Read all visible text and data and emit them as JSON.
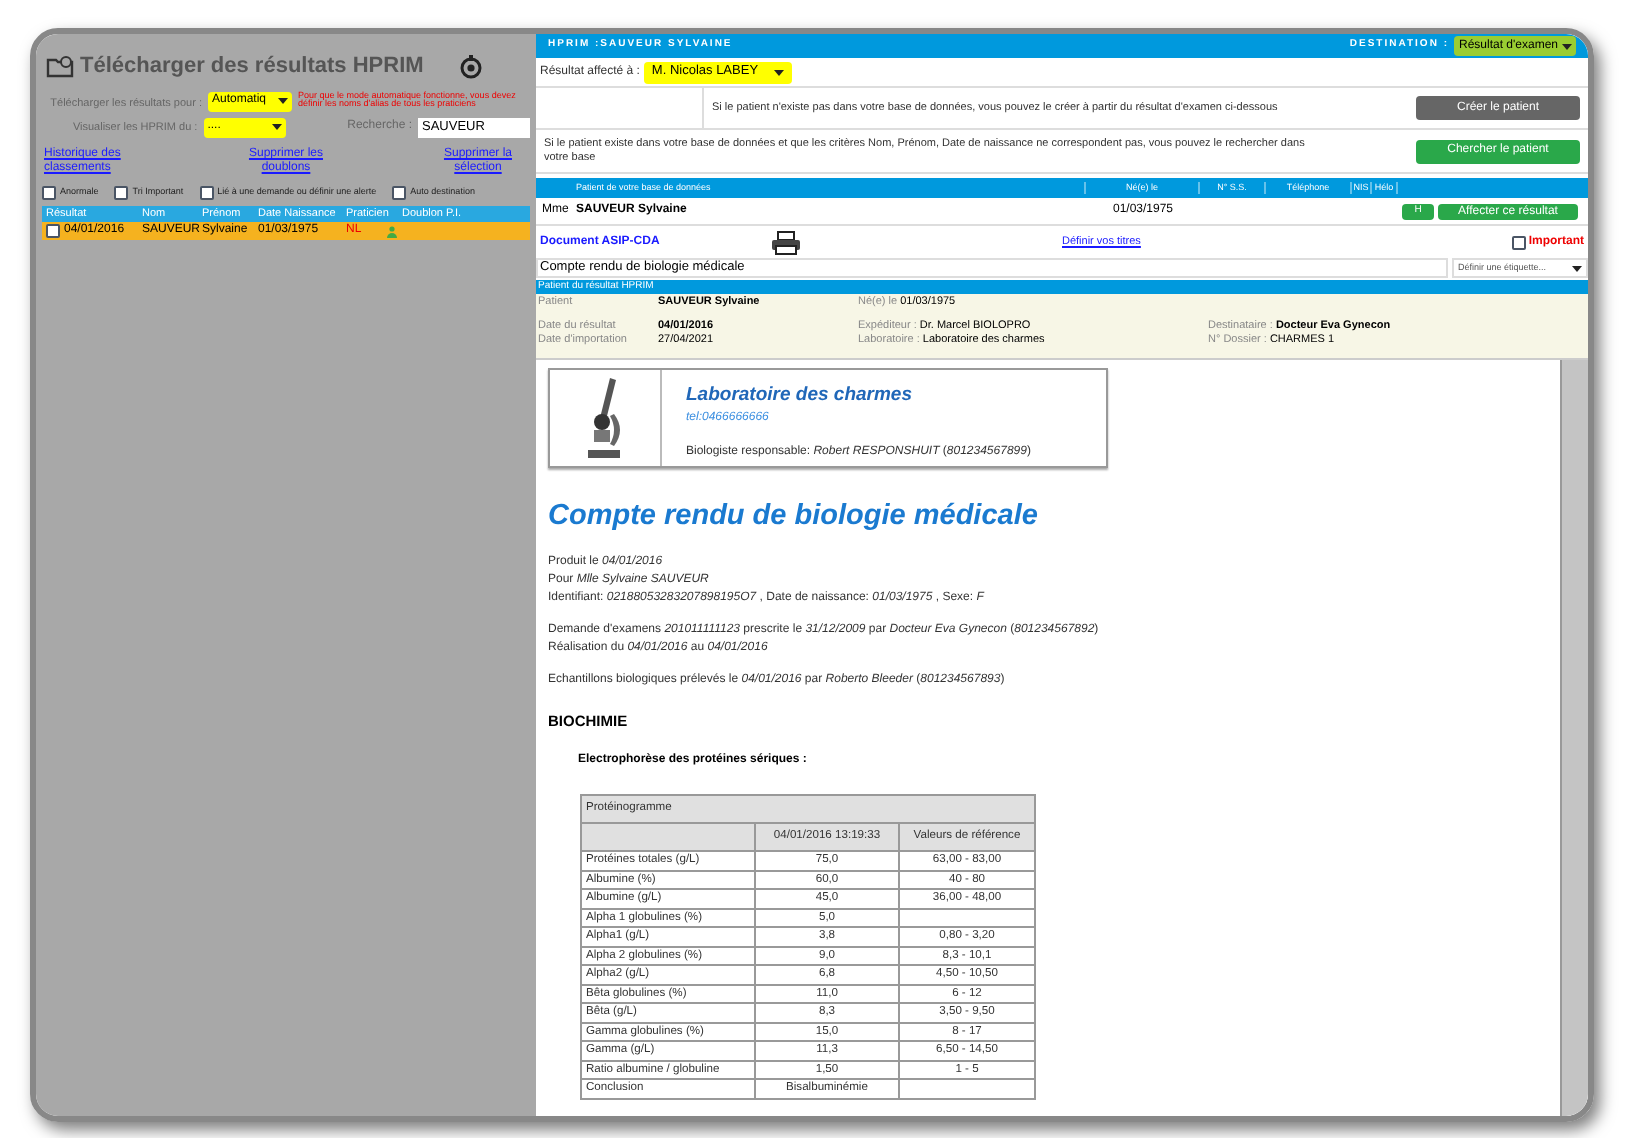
{
  "left": {
    "title": "Télécharger des résultats HPRIM",
    "download_for": {
      "label": "Télécharger les résultats pour :",
      "value": "Automatiq",
      "note": "Pour que le mode automatique fonctionne, vous devez définir les noms d'alias de tous les praticiens"
    },
    "view_hprim": {
      "label": "Visualiser les HPRIM du :",
      "value": "...."
    },
    "search": {
      "label": "Recherche :",
      "value": "SAUVEUR"
    },
    "links": [
      "Historique des classements",
      "Supprimer les doublons",
      "Supprimer la sélection"
    ],
    "filters": [
      {
        "label": "Anormale",
        "checked": false
      },
      {
        "label": "Tri Important",
        "checked": false
      },
      {
        "label": "Lié à une demande ou définir une alerte",
        "checked": false
      },
      {
        "label": "Auto destination",
        "checked": false
      }
    ],
    "table": {
      "columns": [
        "Résultat",
        "Nom",
        "Prénom",
        "Date Naissance",
        "Praticien",
        "Doublon P.I."
      ],
      "rows": [
        {
          "checked": false,
          "selected": true,
          "cells": [
            "04/01/2016",
            "SAUVEUR",
            "Sylvaine",
            "01/03/1975",
            "NL",
            ""
          ]
        }
      ]
    }
  },
  "right": {
    "header": {
      "title": "HPRIM :SAUVEUR SYLVAINE",
      "destination_label": "DESTINATION :",
      "destination_value": "Résultat d'examen"
    },
    "assigned": {
      "label": "Résultat affecté à :",
      "value": "M. Nicolas LABEY"
    },
    "create": {
      "text": "Si le patient n'existe pas dans votre base de données, vous pouvez le créer à partir du résultat d'examen ci-dessous",
      "button": "Créer le patient"
    },
    "find": {
      "text": "Si le patient existe dans votre base de données et que les critères Nom, Prénom, Date de naissance ne correspondent pas, vous pouvez le rechercher dans votre base",
      "button": "Chercher le patient"
    },
    "patients": {
      "columns": [
        "Patient de votre base de données",
        "Né(e) le",
        "N° S.S.",
        "Téléphone",
        "NIS",
        "Hélo"
      ],
      "rows": [
        {
          "civility": "Mme",
          "name": "SAUVEUR Sylvaine",
          "birth": "01/03/1975",
          "h_button": "H",
          "assign_button": "Affecter ce résultat"
        }
      ]
    },
    "document": {
      "type_link": "Document ASIP-CDA",
      "titles_link": "Définir vos titres",
      "important": {
        "label": "Important",
        "checked": false
      },
      "title_value": "Compte rendu de biologie médicale",
      "label_select": "Définir une étiquette..."
    },
    "hprim_patient": {
      "header": "Patient du résultat HPRIM",
      "fields": [
        {
          "label": "Patient",
          "value": "SAUVEUR Sylvaine"
        },
        {
          "label": "Né(e) le",
          "value": "01/03/1975"
        },
        {
          "label": "Date du résultat",
          "value": "04/01/2016"
        },
        {
          "label": "Expéditeur :",
          "value": "Dr. Marcel BIOLOPRO"
        },
        {
          "label": "Destinataire :",
          "value": "Docteur Eva Gynecon"
        },
        {
          "label": "Date d'importation",
          "value": "27/04/2021"
        },
        {
          "label": "Laboratoire :",
          "value": "Laboratoire des charmes"
        },
        {
          "label": "N° Dossier :",
          "value": "CHARMES 1"
        }
      ]
    },
    "report": {
      "lab_name": "Laboratoire des charmes",
      "tel": "tel:0466666666",
      "biologist": "Biologiste responsable: *Robert RESPONSHUIT* (*801234567899*)",
      "title": "Compte rendu de biologie médicale",
      "paragraphs": [
        [
          "Produit le *04/01/2016*",
          "Pour *Mlle Sylvaine SAUVEUR*",
          "Identifiant: *02188053283207898195O7* , Date de naissance: *01/03/1975* , Sexe: *F*"
        ],
        [
          "Demande d'examens *201011111123* prescrite le *31/12/2009* par *Docteur Eva Gynecon* (*801234567892*)",
          "Réalisation du *04/01/2016* au *04/01/2016*"
        ],
        [
          "Echantillons biologiques prélevés le *04/01/2016* par *Roberto Bleeder* (*801234567893*)"
        ]
      ],
      "section": "BIOCHIMIE",
      "subsection": "Electrophorèse des protéines sériques :",
      "table": {
        "caption": "Protéinogramme",
        "columns": [
          "",
          "04/01/2016 13:19:33",
          "Valeurs de référence"
        ],
        "rows": [
          [
            "Protéines totales (g/L)",
            "75,0",
            "63,00 - 83,00"
          ],
          [
            "Albumine (%)",
            "60,0",
            "40 - 80"
          ],
          [
            "Albumine (g/L)",
            "45,0",
            "36,00 - 48,00"
          ],
          [
            "Alpha 1 globulines (%)",
            "5,0",
            ""
          ],
          [
            "Alpha1 (g/L)",
            "3,8",
            "0,80 - 3,20"
          ],
          [
            "Alpha 2 globulines (%)",
            "9,0",
            "8,3 - 10,1"
          ],
          [
            "Alpha2 (g/L)",
            "6,8",
            "4,50 - 10,50"
          ],
          [
            "Bêta globulines (%)",
            "11,0",
            "6 - 12"
          ],
          [
            "Bêta (g/L)",
            "8,3",
            "3,50 - 9,50"
          ],
          [
            "Gamma globulines (%)",
            "15,0",
            "8 - 17"
          ],
          [
            "Gamma (g/L)",
            "11,3",
            "6,50 - 14,50"
          ],
          [
            "Ratio albumine / globuline",
            "1,50",
            "1 - 5"
          ],
          [
            "Conclusion",
            "Bisalbuminémie",
            ""
          ]
        ]
      }
    }
  }
}
